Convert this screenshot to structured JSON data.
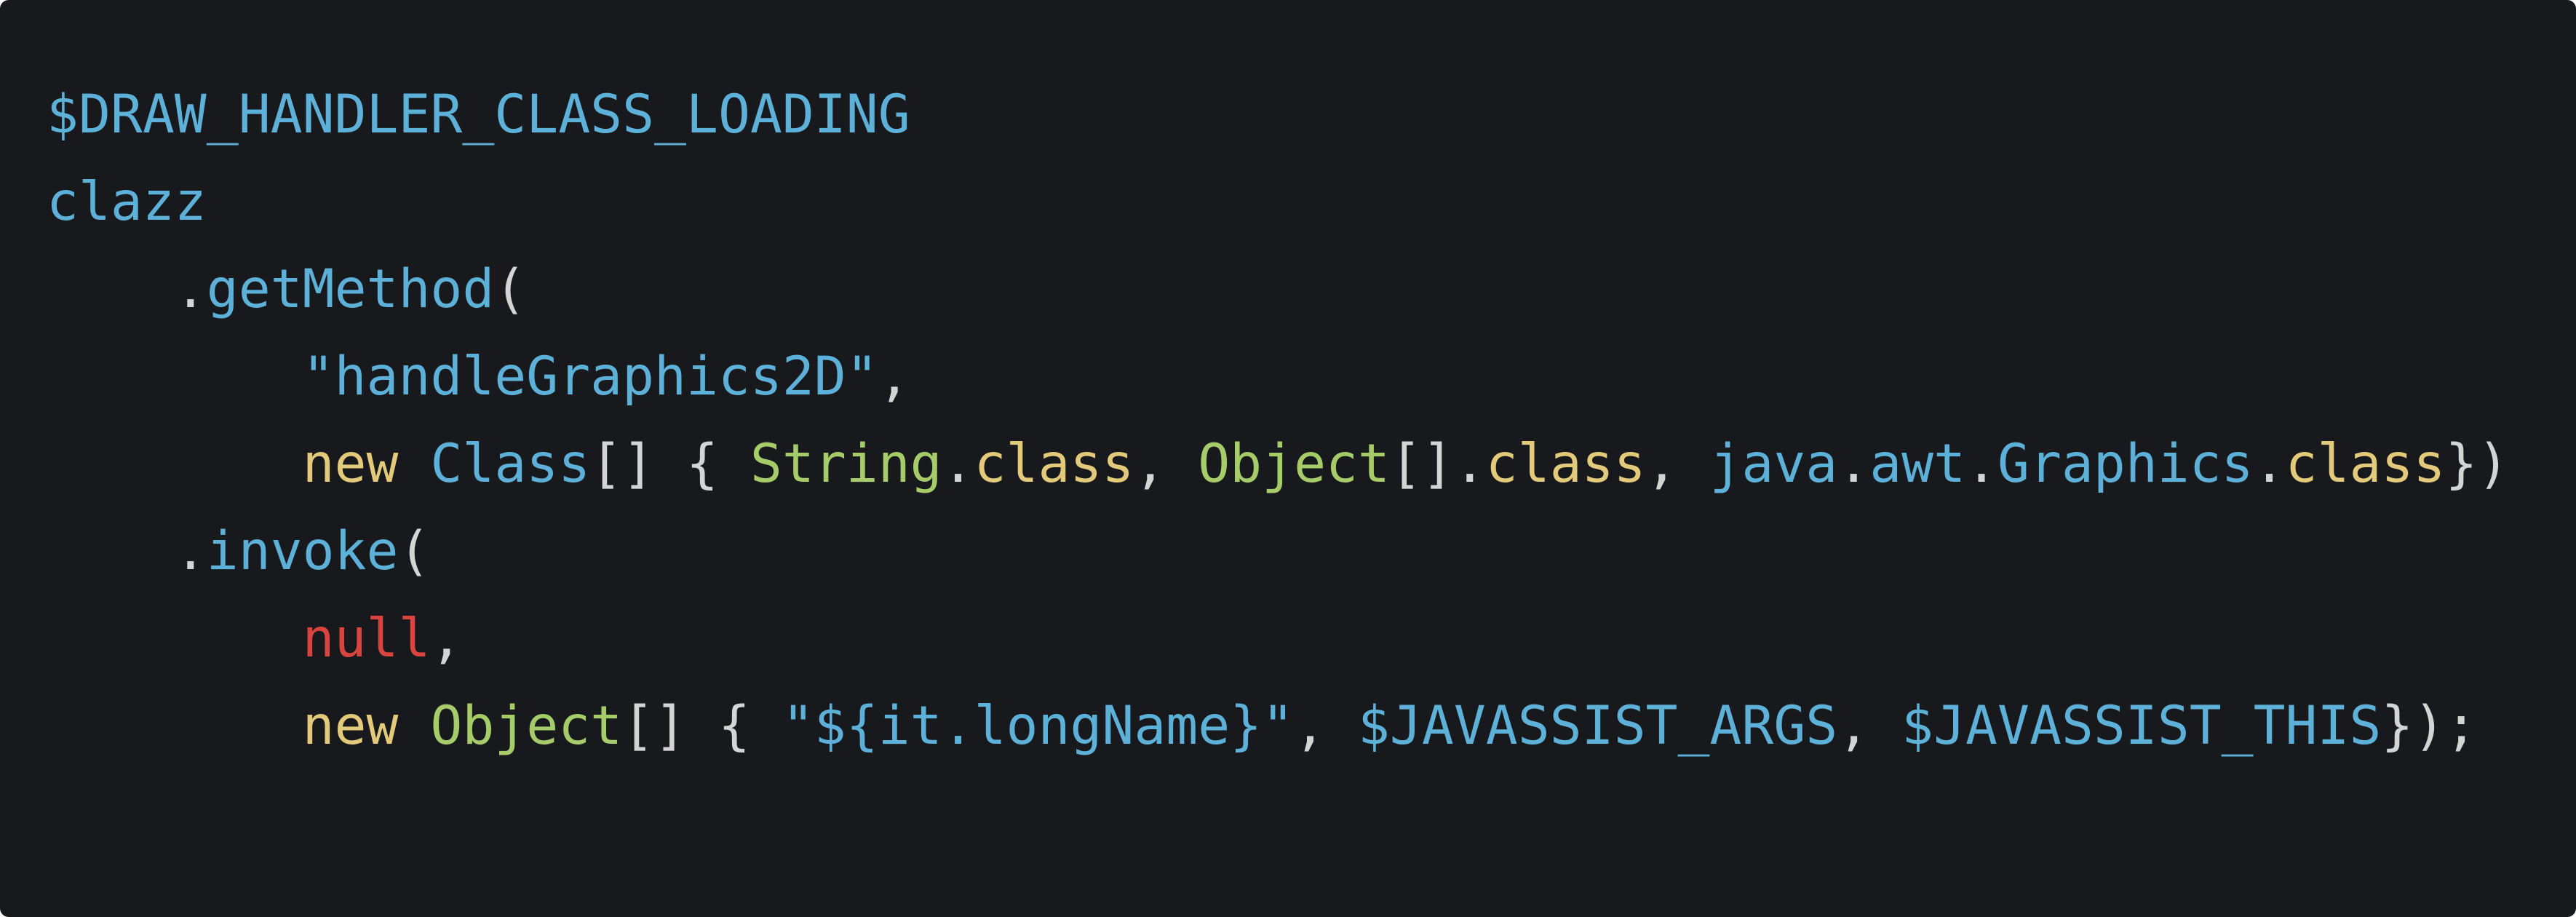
{
  "colors": {
    "background": "#17191c",
    "identifier": "#5db0d7",
    "punctuation": "#d4d4d4",
    "keyword": "#e3c97a",
    "type": "#a6cc6a",
    "null": "#d9443f",
    "string": "#5db0d7"
  },
  "lines": [
    {
      "indent": 0,
      "tokens": [
        {
          "text": "$DRAW_HANDLER_CLASS_LOADING",
          "kind": "identifier"
        }
      ]
    },
    {
      "indent": 0,
      "tokens": [
        {
          "text": "clazz",
          "kind": "identifier"
        }
      ]
    },
    {
      "indent": 1,
      "tokens": [
        {
          "text": ".",
          "kind": "punctuation"
        },
        {
          "text": "getMethod",
          "kind": "identifier"
        },
        {
          "text": "(",
          "kind": "punctuation"
        }
      ]
    },
    {
      "indent": 2,
      "tokens": [
        {
          "text": "\"handleGraphics2D\"",
          "kind": "string"
        },
        {
          "text": ",",
          "kind": "punctuation"
        }
      ]
    },
    {
      "indent": 2,
      "tokens": [
        {
          "text": "new",
          "kind": "keyword"
        },
        {
          "text": " ",
          "kind": "punctuation"
        },
        {
          "text": "Class",
          "kind": "identifier"
        },
        {
          "text": "[] { ",
          "kind": "punctuation"
        },
        {
          "text": "String",
          "kind": "type"
        },
        {
          "text": ".",
          "kind": "punctuation"
        },
        {
          "text": "class",
          "kind": "keyword"
        },
        {
          "text": ", ",
          "kind": "punctuation"
        },
        {
          "text": "Object",
          "kind": "type"
        },
        {
          "text": "[].",
          "kind": "punctuation"
        },
        {
          "text": "class",
          "kind": "keyword"
        },
        {
          "text": ", ",
          "kind": "punctuation"
        },
        {
          "text": "java",
          "kind": "identifier"
        },
        {
          "text": ".",
          "kind": "punctuation"
        },
        {
          "text": "awt",
          "kind": "identifier"
        },
        {
          "text": ".",
          "kind": "punctuation"
        },
        {
          "text": "Graphics",
          "kind": "identifier"
        },
        {
          "text": ".",
          "kind": "punctuation"
        },
        {
          "text": "class",
          "kind": "keyword"
        },
        {
          "text": "})",
          "kind": "punctuation"
        }
      ]
    },
    {
      "indent": 1,
      "tokens": [
        {
          "text": ".",
          "kind": "punctuation"
        },
        {
          "text": "invoke",
          "kind": "identifier"
        },
        {
          "text": "(",
          "kind": "punctuation"
        }
      ]
    },
    {
      "indent": 2,
      "tokens": [
        {
          "text": "null",
          "kind": "null"
        },
        {
          "text": ",",
          "kind": "punctuation"
        }
      ]
    },
    {
      "indent": 2,
      "tokens": [
        {
          "text": "new",
          "kind": "keyword"
        },
        {
          "text": " ",
          "kind": "punctuation"
        },
        {
          "text": "Object",
          "kind": "type"
        },
        {
          "text": "[] { ",
          "kind": "punctuation"
        },
        {
          "text": "\"${it.longName}\"",
          "kind": "string"
        },
        {
          "text": ", ",
          "kind": "punctuation"
        },
        {
          "text": "$JAVASSIST_ARGS",
          "kind": "identifier"
        },
        {
          "text": ", ",
          "kind": "punctuation"
        },
        {
          "text": "$JAVASSIST_THIS",
          "kind": "identifier"
        },
        {
          "text": "});",
          "kind": "punctuation"
        }
      ]
    }
  ]
}
